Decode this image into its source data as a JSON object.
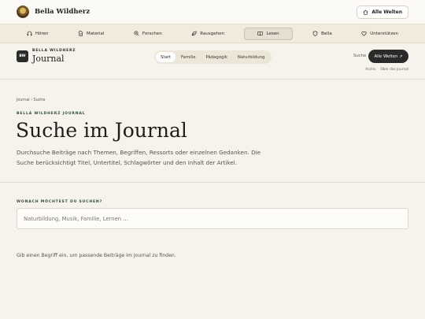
{
  "topbar": {
    "brand_name": "Bella Wildherz",
    "worlds_button": "Alle Welten"
  },
  "nav": {
    "items": [
      {
        "label": "Hören",
        "icon": "headphones-icon"
      },
      {
        "label": "Material",
        "icon": "file-icon"
      },
      {
        "label": "Forschen",
        "icon": "search-plus-icon"
      },
      {
        "label": "Rausgehen",
        "icon": "leaf-icon"
      },
      {
        "label": "Lesen",
        "icon": "book-icon",
        "active": true
      },
      {
        "label": "Bella",
        "icon": "shield-icon"
      },
      {
        "label": "Unterstützen",
        "icon": "heart-icon"
      }
    ]
  },
  "journal": {
    "badge": "BW",
    "brand_small": "BELLA WILDHERZ",
    "brand_big": "Journal",
    "pills": [
      "Start",
      "Familie",
      "Pädagogik",
      "Naturbildung"
    ],
    "active_pill": "Start",
    "search_link": "Suche",
    "worlds_button": "Alle Welten ↗",
    "links": [
      "Archiv",
      "Über das Journal"
    ]
  },
  "hero": {
    "breadcrumb": "Journal › Suche",
    "kicker": "BELLA WILDHERZ JOURNAL",
    "title": "Suche im Journal",
    "lead": "Durchsuche Beiträge nach Themen, Begriffen, Ressorts oder einzelnen Gedanken. Die Suche berücksichtigt Titel, Untertitel, Schlagwörter und den Inhalt der Artikel."
  },
  "search": {
    "label": "WONACH MÖCHTEST DU SUCHEN?",
    "value": "",
    "placeholder": "Naturbildung, Musik, Familie, Lernen …",
    "hint": "Gib einen Begriff ein, um passende Beiträge im Journal zu finden."
  }
}
